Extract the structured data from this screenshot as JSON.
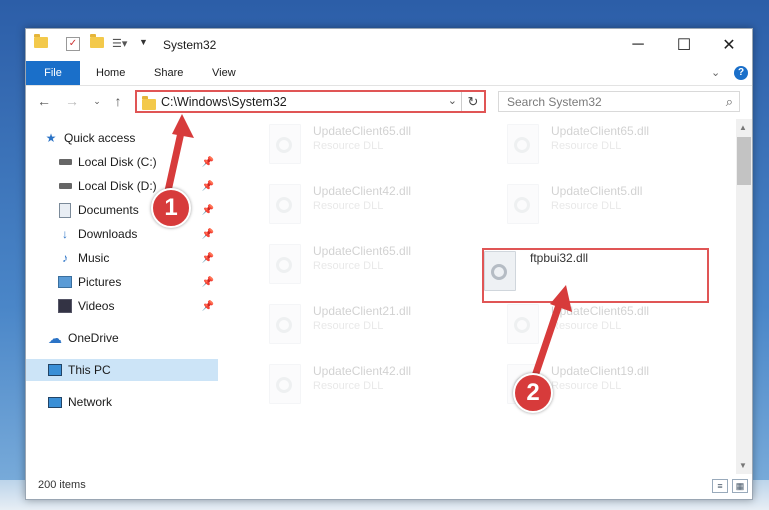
{
  "window": {
    "title": "System32",
    "controls": {
      "minimize": "─",
      "maximize": "☐",
      "close": "✕"
    }
  },
  "ribbon": {
    "tabs": [
      {
        "label": "File"
      },
      {
        "label": "Home"
      },
      {
        "label": "Share"
      },
      {
        "label": "View"
      }
    ],
    "help": "?"
  },
  "nav": {
    "address": "C:\\Windows\\System32",
    "search_placeholder": "Search System32"
  },
  "sidebar": {
    "items": [
      {
        "label": "Quick access",
        "icon": "star-icon"
      },
      {
        "label": "Local Disk (C:)",
        "icon": "drive-icon",
        "pinned": true
      },
      {
        "label": "Local Disk (D:)",
        "icon": "drive-icon",
        "pinned": true
      },
      {
        "label": "Documents",
        "icon": "documents-icon",
        "pinned": true
      },
      {
        "label": "Downloads",
        "icon": "download-icon",
        "pinned": true
      },
      {
        "label": "Music",
        "icon": "music-icon",
        "pinned": true
      },
      {
        "label": "Pictures",
        "icon": "pictures-icon",
        "pinned": true
      },
      {
        "label": "Videos",
        "icon": "video-icon",
        "pinned": true
      },
      {
        "label": "OneDrive",
        "icon": "cloud-icon"
      },
      {
        "label": "This PC",
        "icon": "computer-icon",
        "selected": true
      },
      {
        "label": "Network",
        "icon": "network-icon"
      }
    ]
  },
  "files": [
    {
      "name": "UpdateClient65.dll",
      "type": "Resource DLL"
    },
    {
      "name": "UpdateClient65.dll",
      "type": "Resource DLL"
    },
    {
      "name": "UpdateClient42.dll",
      "type": "Resource DLL"
    },
    {
      "name": "UpdateClient5.dll",
      "type": "Resource DLL"
    },
    {
      "name": "UpdateClient65.dll",
      "type": "Resource DLL"
    },
    {
      "name": "ftpbui32.dll",
      "type": ""
    },
    {
      "name": "UpdateClient21.dll",
      "type": "Resource DLL"
    },
    {
      "name": "UpdateClient65.dll",
      "type": "Resource DLL"
    },
    {
      "name": "UpdateClient42.dll",
      "type": "Resource DLL"
    },
    {
      "name": "UpdateClient19.dll",
      "type": "Resource DLL"
    }
  ],
  "status": {
    "count": "200 items"
  },
  "annotations": {
    "step1": "1",
    "step2": "2"
  },
  "colors": {
    "accent": "#1a6fc9",
    "highlight": "#e05555",
    "badge": "#d73b3b"
  }
}
